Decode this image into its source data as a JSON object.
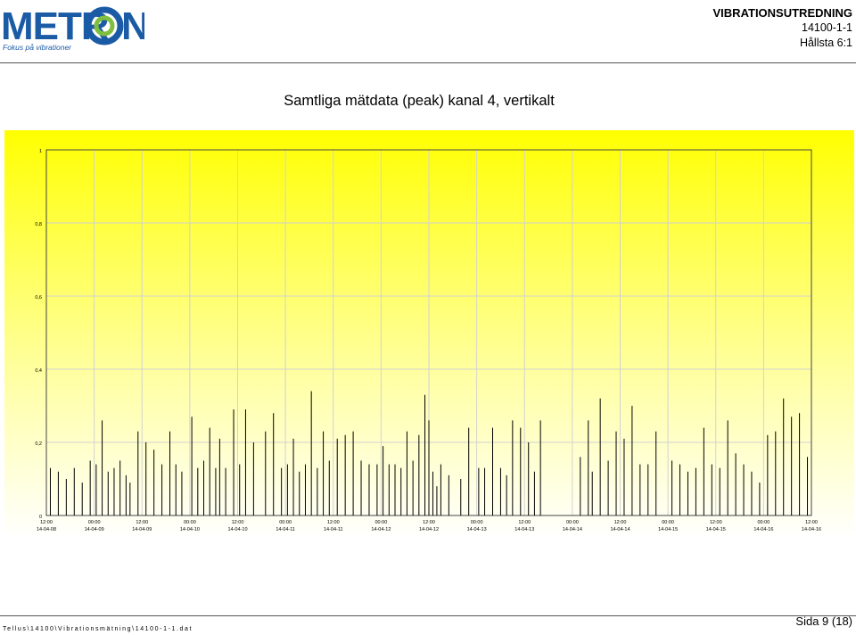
{
  "logo": {
    "name": "METRON",
    "tagline": "Fokus på vibrationer"
  },
  "header": {
    "title": "VIBRATIONSUTREDNING",
    "report_no": "14100-1-1",
    "location": "Hållsta 6:1"
  },
  "page_title": "Samtliga mätdata (peak) kanal 4, vertikalt",
  "footer": {
    "path": "Tellus\\14100\\Vibrationsmätning\\14100-1-1.dat",
    "page": "Sida 9 (18)"
  },
  "colors": {
    "brand_blue": "#1b5ba6",
    "brand_green": "#7fbf3f",
    "chart_bg_top": "#ffff00",
    "bar": "#000000",
    "grid": "#d2d2d2"
  },
  "chart_data": {
    "type": "bar",
    "title": "",
    "xlabel": "",
    "ylabel": "",
    "ylim": [
      0,
      1
    ],
    "yticks": [
      "0",
      "0,2",
      "0,4",
      "0,6",
      "0,8",
      "1"
    ],
    "ytick_values": [
      0,
      0.2,
      0.4,
      0.6,
      0.8,
      1.0
    ],
    "x_start": "14-04-08 12:00",
    "x_end": "14-04-16 12:00",
    "xticks": [
      {
        "time": "12:00",
        "date": "14-04-08"
      },
      {
        "time": "00:00",
        "date": "14-04-09"
      },
      {
        "time": "12:00",
        "date": "14-04-09"
      },
      {
        "time": "00:00",
        "date": "14-04-10"
      },
      {
        "time": "12:00",
        "date": "14-04-10"
      },
      {
        "time": "00:00",
        "date": "14-04-11"
      },
      {
        "time": "12:00",
        "date": "14-04-11"
      },
      {
        "time": "00:00",
        "date": "14-04-12"
      },
      {
        "time": "12:00",
        "date": "14-04-12"
      },
      {
        "time": "00:00",
        "date": "14-04-13"
      },
      {
        "time": "12:00",
        "date": "14-04-13"
      },
      {
        "time": "00:00",
        "date": "14-04-14"
      },
      {
        "time": "12:00",
        "date": "14-04-14"
      },
      {
        "time": "00:00",
        "date": "14-04-15"
      },
      {
        "time": "12:00",
        "date": "14-04-15"
      },
      {
        "time": "00:00",
        "date": "14-04-16"
      },
      {
        "time": "12:00",
        "date": "14-04-16"
      }
    ],
    "grid": true,
    "series": [
      {
        "peaks": [
          {
            "x": "14-04-08 13:00",
            "y": 0.13
          },
          {
            "x": "14-04-08 15:00",
            "y": 0.12
          },
          {
            "x": "14-04-08 17:00",
            "y": 0.1
          },
          {
            "x": "14-04-08 19:00",
            "y": 0.13
          },
          {
            "x": "14-04-08 21:00",
            "y": 0.09
          },
          {
            "x": "14-04-08 23:00",
            "y": 0.15
          },
          {
            "x": "14-04-09 00:30",
            "y": 0.14
          },
          {
            "x": "14-04-09 02:00",
            "y": 0.26
          },
          {
            "x": "14-04-09 03:30",
            "y": 0.12
          },
          {
            "x": "14-04-09 05:00",
            "y": 0.13
          },
          {
            "x": "14-04-09 06:30",
            "y": 0.15
          },
          {
            "x": "14-04-09 08:00",
            "y": 0.11
          },
          {
            "x": "14-04-09 09:00",
            "y": 0.09
          },
          {
            "x": "14-04-09 11:00",
            "y": 0.23
          },
          {
            "x": "14-04-09 13:00",
            "y": 0.2
          },
          {
            "x": "14-04-09 15:00",
            "y": 0.18
          },
          {
            "x": "14-04-09 17:00",
            "y": 0.14
          },
          {
            "x": "14-04-09 19:00",
            "y": 0.23
          },
          {
            "x": "14-04-09 20:30",
            "y": 0.14
          },
          {
            "x": "14-04-09 22:00",
            "y": 0.12
          },
          {
            "x": "14-04-10 00:30",
            "y": 0.27
          },
          {
            "x": "14-04-10 02:00",
            "y": 0.13
          },
          {
            "x": "14-04-10 03:30",
            "y": 0.15
          },
          {
            "x": "14-04-10 05:00",
            "y": 0.24
          },
          {
            "x": "14-04-10 06:30",
            "y": 0.13
          },
          {
            "x": "14-04-10 07:30",
            "y": 0.21
          },
          {
            "x": "14-04-10 09:00",
            "y": 0.13
          },
          {
            "x": "14-04-10 11:00",
            "y": 0.29
          },
          {
            "x": "14-04-10 12:30",
            "y": 0.14
          },
          {
            "x": "14-04-10 14:00",
            "y": 0.29
          },
          {
            "x": "14-04-10 16:00",
            "y": 0.2
          },
          {
            "x": "14-04-10 19:00",
            "y": 0.23
          },
          {
            "x": "14-04-10 21:00",
            "y": 0.28
          },
          {
            "x": "14-04-10 23:00",
            "y": 0.13
          },
          {
            "x": "14-04-11 00:30",
            "y": 0.14
          },
          {
            "x": "14-04-11 02:00",
            "y": 0.21
          },
          {
            "x": "14-04-11 03:30",
            "y": 0.12
          },
          {
            "x": "14-04-11 05:00",
            "y": 0.14
          },
          {
            "x": "14-04-11 06:30",
            "y": 0.34
          },
          {
            "x": "14-04-11 08:00",
            "y": 0.13
          },
          {
            "x": "14-04-11 09:30",
            "y": 0.23
          },
          {
            "x": "14-04-11 11:00",
            "y": 0.15
          },
          {
            "x": "14-04-11 13:00",
            "y": 0.21
          },
          {
            "x": "14-04-11 15:00",
            "y": 0.22
          },
          {
            "x": "14-04-11 17:00",
            "y": 0.23
          },
          {
            "x": "14-04-11 19:00",
            "y": 0.15
          },
          {
            "x": "14-04-11 21:00",
            "y": 0.14
          },
          {
            "x": "14-04-11 23:00",
            "y": 0.14
          },
          {
            "x": "14-04-12 00:30",
            "y": 0.19
          },
          {
            "x": "14-04-12 02:00",
            "y": 0.14
          },
          {
            "x": "14-04-12 03:30",
            "y": 0.14
          },
          {
            "x": "14-04-12 05:00",
            "y": 0.13
          },
          {
            "x": "14-04-12 06:30",
            "y": 0.23
          },
          {
            "x": "14-04-12 08:00",
            "y": 0.15
          },
          {
            "x": "14-04-12 09:30",
            "y": 0.22
          },
          {
            "x": "14-04-12 11:00",
            "y": 0.33
          },
          {
            "x": "14-04-12 12:00",
            "y": 0.26
          },
          {
            "x": "14-04-12 13:00",
            "y": 0.12
          },
          {
            "x": "14-04-12 14:00",
            "y": 0.08
          },
          {
            "x": "14-04-12 15:00",
            "y": 0.14
          },
          {
            "x": "14-04-12 17:00",
            "y": 0.11
          },
          {
            "x": "14-04-12 20:00",
            "y": 0.1
          },
          {
            "x": "14-04-12 22:00",
            "y": 0.24
          },
          {
            "x": "14-04-13 00:30",
            "y": 0.13
          },
          {
            "x": "14-04-13 02:00",
            "y": 0.13
          },
          {
            "x": "14-04-13 04:00",
            "y": 0.24
          },
          {
            "x": "14-04-13 06:00",
            "y": 0.13
          },
          {
            "x": "14-04-13 07:30",
            "y": 0.11
          },
          {
            "x": "14-04-13 09:00",
            "y": 0.26
          },
          {
            "x": "14-04-13 11:00",
            "y": 0.24
          },
          {
            "x": "14-04-13 13:00",
            "y": 0.2
          },
          {
            "x": "14-04-13 14:30",
            "y": 0.12
          },
          {
            "x": "14-04-13 16:00",
            "y": 0.26
          },
          {
            "x": "14-04-14 02:00",
            "y": 0.16
          },
          {
            "x": "14-04-14 04:00",
            "y": 0.26
          },
          {
            "x": "14-04-14 05:00",
            "y": 0.12
          },
          {
            "x": "14-04-14 07:00",
            "y": 0.32
          },
          {
            "x": "14-04-14 09:00",
            "y": 0.15
          },
          {
            "x": "14-04-14 11:00",
            "y": 0.23
          },
          {
            "x": "14-04-14 13:00",
            "y": 0.21
          },
          {
            "x": "14-04-14 15:00",
            "y": 0.3
          },
          {
            "x": "14-04-14 17:00",
            "y": 0.14
          },
          {
            "x": "14-04-14 19:00",
            "y": 0.14
          },
          {
            "x": "14-04-14 21:00",
            "y": 0.23
          },
          {
            "x": "14-04-15 01:00",
            "y": 0.15
          },
          {
            "x": "14-04-15 03:00",
            "y": 0.14
          },
          {
            "x": "14-04-15 05:00",
            "y": 0.12
          },
          {
            "x": "14-04-15 07:00",
            "y": 0.13
          },
          {
            "x": "14-04-15 09:00",
            "y": 0.24
          },
          {
            "x": "14-04-15 11:00",
            "y": 0.14
          },
          {
            "x": "14-04-15 13:00",
            "y": 0.13
          },
          {
            "x": "14-04-15 15:00",
            "y": 0.26
          },
          {
            "x": "14-04-15 17:00",
            "y": 0.17
          },
          {
            "x": "14-04-15 19:00",
            "y": 0.14
          },
          {
            "x": "14-04-15 21:00",
            "y": 0.12
          },
          {
            "x": "14-04-15 23:00",
            "y": 0.09
          },
          {
            "x": "14-04-16 01:00",
            "y": 0.22
          },
          {
            "x": "14-04-16 03:00",
            "y": 0.23
          },
          {
            "x": "14-04-16 05:00",
            "y": 0.32
          },
          {
            "x": "14-04-16 07:00",
            "y": 0.27
          },
          {
            "x": "14-04-16 09:00",
            "y": 0.28
          },
          {
            "x": "14-04-16 11:00",
            "y": 0.16
          },
          {
            "x": "14-04-16 13:00",
            "y": 0.23
          },
          {
            "x": "14-04-16 15:00",
            "y": 0.24
          },
          {
            "x": "14-04-16 17:00",
            "y": 0.13
          },
          {
            "x": "14-04-16 19:00",
            "y": 0.29
          },
          {
            "x": "14-04-16 21:00",
            "y": 0.13
          },
          {
            "x": "14-04-16 23:00",
            "y": 0.21
          },
          {
            "x": "14-04-17 02:00",
            "y": 0.24
          },
          {
            "x": "14-04-17 04:00",
            "y": 0.22
          },
          {
            "x": "14-04-17 06:00",
            "y": 0.29
          },
          {
            "x": "14-04-17 08:00",
            "y": 0.13
          },
          {
            "x": "14-04-17 10:00",
            "y": 0.2
          },
          {
            "x": "14-04-17 12:00",
            "y": 0.14
          },
          {
            "x": "14-04-17 14:00",
            "y": 0.25
          },
          {
            "x": "14-04-17 16:00",
            "y": 0.14
          },
          {
            "x": "14-04-17 18:00",
            "y": 0.13
          },
          {
            "x": "14-04-17 21:00",
            "y": 0.24
          }
        ]
      }
    ]
  }
}
